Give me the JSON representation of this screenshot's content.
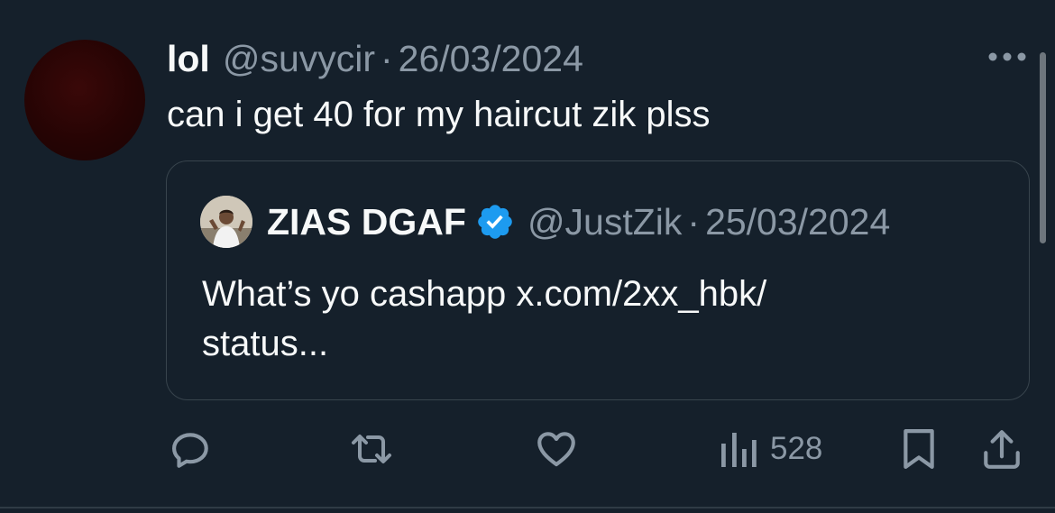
{
  "tweet": {
    "display_name": "lol",
    "handle": "@suvycir",
    "separator": "·",
    "date": "26/03/2024",
    "text": "can i get 40 for my haircut zik plss"
  },
  "quoted_tweet": {
    "display_name": "ZIAS DGAF",
    "verified": true,
    "handle": "@JustZik",
    "separator": "·",
    "date": "25/03/2024",
    "text": "What’s yo cashapp x.com/2xx_hbk/ status..."
  },
  "actions": {
    "reply_icon": "reply-icon",
    "retweet_icon": "retweet-icon",
    "like_icon": "heart-icon",
    "views_icon": "views-icon",
    "views_count": "528",
    "bookmark_icon": "bookmark-icon",
    "share_icon": "share-icon"
  },
  "colors": {
    "background": "#15202b",
    "text_primary": "#f7f9f9",
    "text_secondary": "#8b98a5",
    "border": "#38444d",
    "verified_blue": "#1d9bf0"
  }
}
